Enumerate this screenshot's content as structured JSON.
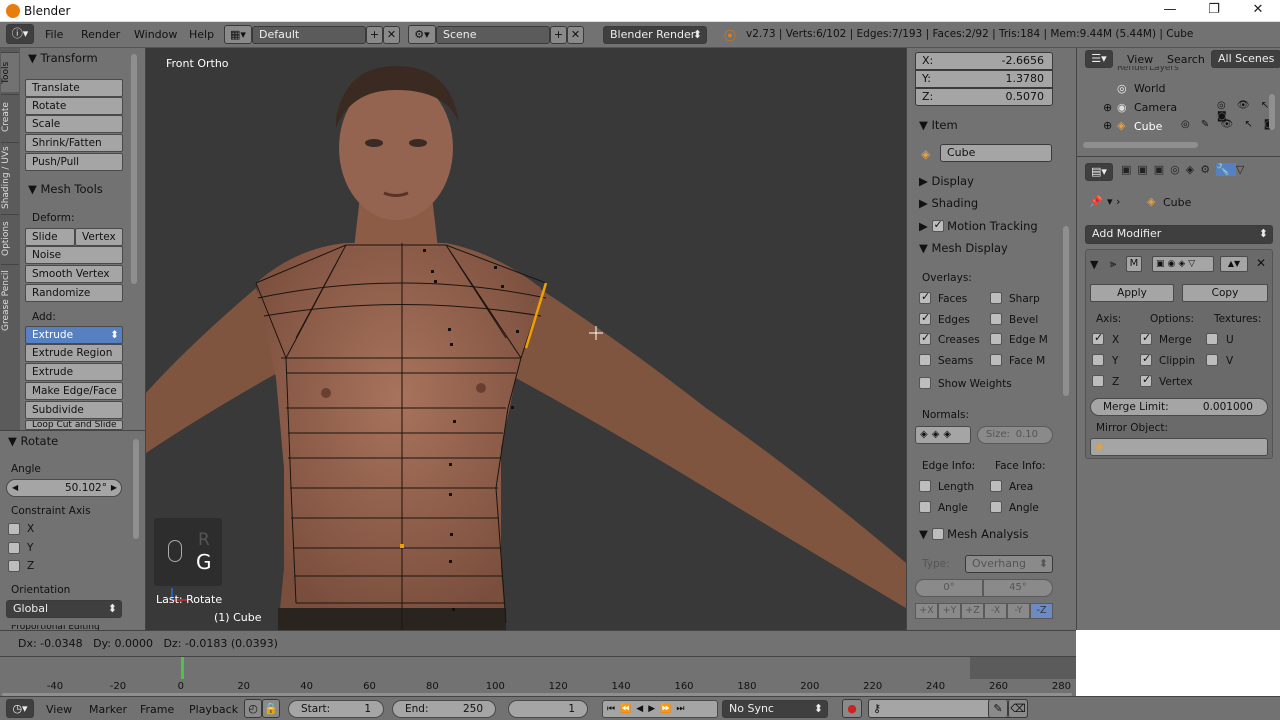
{
  "window": {
    "title": "Blender",
    "min": "—",
    "max": "❐",
    "close": "✕"
  },
  "header": {
    "menus": [
      "File",
      "Render",
      "Window",
      "Help"
    ],
    "screen_layout": "Default",
    "scene": "Scene",
    "render_engine": "Blender Render",
    "stats": "v2.73 | Verts:6/102 | Edges:7/193 | Faces:2/92 | Tris:184 | Mem:9.44M (5.44M) | Cube"
  },
  "left_tabs": [
    "Tools",
    "Create",
    "Shading / UVs",
    "Options",
    "Grease Pencil"
  ],
  "transform": {
    "title": "Transform",
    "buttons": [
      "Translate",
      "Rotate",
      "Scale",
      "Shrink/Fatten",
      "Push/Pull"
    ]
  },
  "mesh_tools": {
    "title": "Mesh Tools",
    "deform_label": "Deform:",
    "slide_edge": "Slide Ed",
    "vertex": "Vertex",
    "noise": "Noise",
    "smooth_vertex": "Smooth Vertex",
    "randomize": "Randomize",
    "add_label": "Add:",
    "extrude": "Extrude",
    "extrude_region": "Extrude Region",
    "extrude_individual": "Extrude Individual",
    "make_edge_face": "Make Edge/Face",
    "subdivide": "Subdivide",
    "loop_cut": "Loop Cut and Slide"
  },
  "rotate_op": {
    "title": "Rotate",
    "angle_label": "Angle",
    "angle_value": "50.102°",
    "constraint_label": "Constraint Axis",
    "axes": [
      "X",
      "Y",
      "Z"
    ],
    "orientation_label": "Orientation",
    "orientation_value": "Global",
    "proportional": "Proportional Editing"
  },
  "viewport": {
    "view_label": "Front Ortho",
    "last_op": "Last: Rotate",
    "object_label": "(1) Cube",
    "key_r": "R",
    "key_g": "G"
  },
  "npanel": {
    "x_label": "X:",
    "x_value": "-2.6656",
    "y_label": "Y:",
    "y_value": "1.3780",
    "z_label": "Z:",
    "z_value": "0.5070",
    "item_title": "Item",
    "item_name": "Cube",
    "display": "Display",
    "shading": "Shading",
    "motion_tracking": "Motion Tracking",
    "mesh_display": "Mesh Display",
    "overlays_label": "Overlays:",
    "overlays": [
      {
        "label": "Faces",
        "on": true
      },
      {
        "label": "Sharp",
        "on": false
      },
      {
        "label": "Edges",
        "on": true
      },
      {
        "label": "Bevel",
        "on": false
      },
      {
        "label": "Creases",
        "on": true
      },
      {
        "label": "Edge M",
        "on": false
      },
      {
        "label": "Seams",
        "on": false
      },
      {
        "label": "Face M",
        "on": false
      }
    ],
    "show_weights": "Show Weights",
    "normals_label": "Normals:",
    "size_label": "Size:",
    "size_value": "0.10",
    "edge_info": "Edge Info:",
    "face_info": "Face Info:",
    "length": "Length",
    "area": "Area",
    "angle1": "Angle",
    "angle2": "Angle",
    "mesh_analysis": "Mesh Analysis",
    "type_label": "Type:",
    "type_value": "Overhang",
    "deg0": "0°",
    "deg45": "45°",
    "axis_buttons": [
      "+X",
      "+Y",
      "+Z",
      "-X",
      "-Y",
      "-Z"
    ]
  },
  "outliner": {
    "menus": [
      "View",
      "Search"
    ],
    "all_scenes": "All Scenes",
    "items": [
      "RenderLayers",
      "World",
      "Camera",
      "Cube"
    ]
  },
  "properties": {
    "breadcrumb": "Cube",
    "add_modifier": "Add Modifier",
    "modifier_short": "M",
    "apply": "Apply",
    "copy": "Copy",
    "axis_label": "Axis:",
    "options_label": "Options:",
    "textures_label": "Textures:",
    "rows": [
      {
        "axis": "X",
        "axis_on": true,
        "opt": "Merge",
        "opt_on": true,
        "tex": "U",
        "tex_on": false
      },
      {
        "axis": "Y",
        "axis_on": false,
        "opt": "Clippin",
        "opt_on": true,
        "tex": "V",
        "tex_on": false
      },
      {
        "axis": "Z",
        "axis_on": false,
        "opt": "Vertex",
        "opt_on": true,
        "tex": "",
        "tex_on": false
      }
    ],
    "merge_limit_label": "Merge Limit:",
    "merge_limit_value": "0.001000",
    "mirror_object_label": "Mirror Object:"
  },
  "infobar": {
    "text": "Dx: -0.0348   Dy: 0.0000   Dz: -0.0183 (0.0393)"
  },
  "timeline": {
    "ticks": [
      "-40",
      "-20",
      "0",
      "20",
      "40",
      "60",
      "80",
      "100",
      "120",
      "140",
      "160",
      "180",
      "200",
      "220",
      "240",
      "260",
      "280"
    ],
    "current_frame_value": 0
  },
  "timeline_header": {
    "menus": [
      "View",
      "Marker",
      "Frame",
      "Playback"
    ],
    "start_label": "Start:",
    "start_value": "1",
    "end_label": "End:",
    "end_value": "250",
    "current": "1",
    "sync": "No Sync"
  },
  "colors": {
    "accent": "#5680c2",
    "panel": "#727272",
    "viewport": "#393939",
    "selected_edge": "#f0a000"
  }
}
